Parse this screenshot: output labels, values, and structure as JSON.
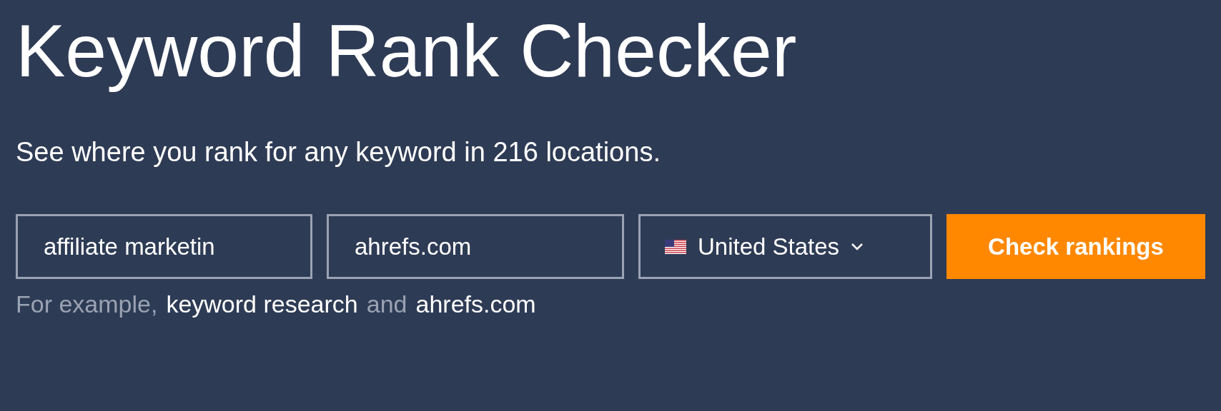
{
  "title": "Keyword Rank Checker",
  "subtitle": "See where you rank for any keyword in 216 locations.",
  "form": {
    "keyword": {
      "value": "affiliate marketin"
    },
    "domain": {
      "value": "ahrefs.com"
    },
    "country": {
      "value": "United States"
    },
    "submit": "Check rankings"
  },
  "example": {
    "prefix": "For example,",
    "keyword_link": "keyword research",
    "joiner": "and",
    "domain_link": "ahrefs.com"
  }
}
